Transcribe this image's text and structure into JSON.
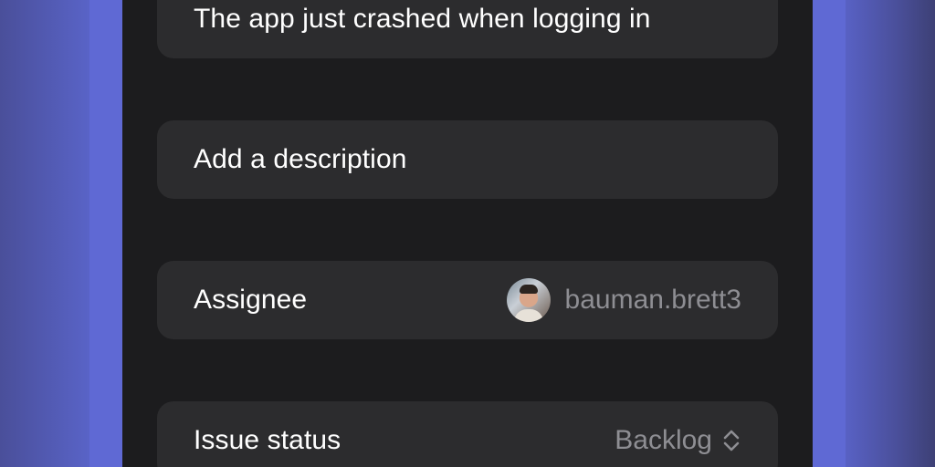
{
  "issue": {
    "title_value": "The app just crashed when logging in",
    "description_placeholder": "Add a description"
  },
  "assignee": {
    "label": "Assignee",
    "username": "bauman.brett3"
  },
  "status": {
    "label": "Issue status",
    "value": "Backlog"
  },
  "icons": {
    "status_picker": "chevron-up-down-icon",
    "avatar": "user-avatar"
  },
  "colors": {
    "background_accent": "#5c66cf",
    "screen_bg": "#1c1c1e",
    "card_bg": "#2c2c2e",
    "primary_text": "#ffffff",
    "secondary_text": "#8e8e93"
  }
}
